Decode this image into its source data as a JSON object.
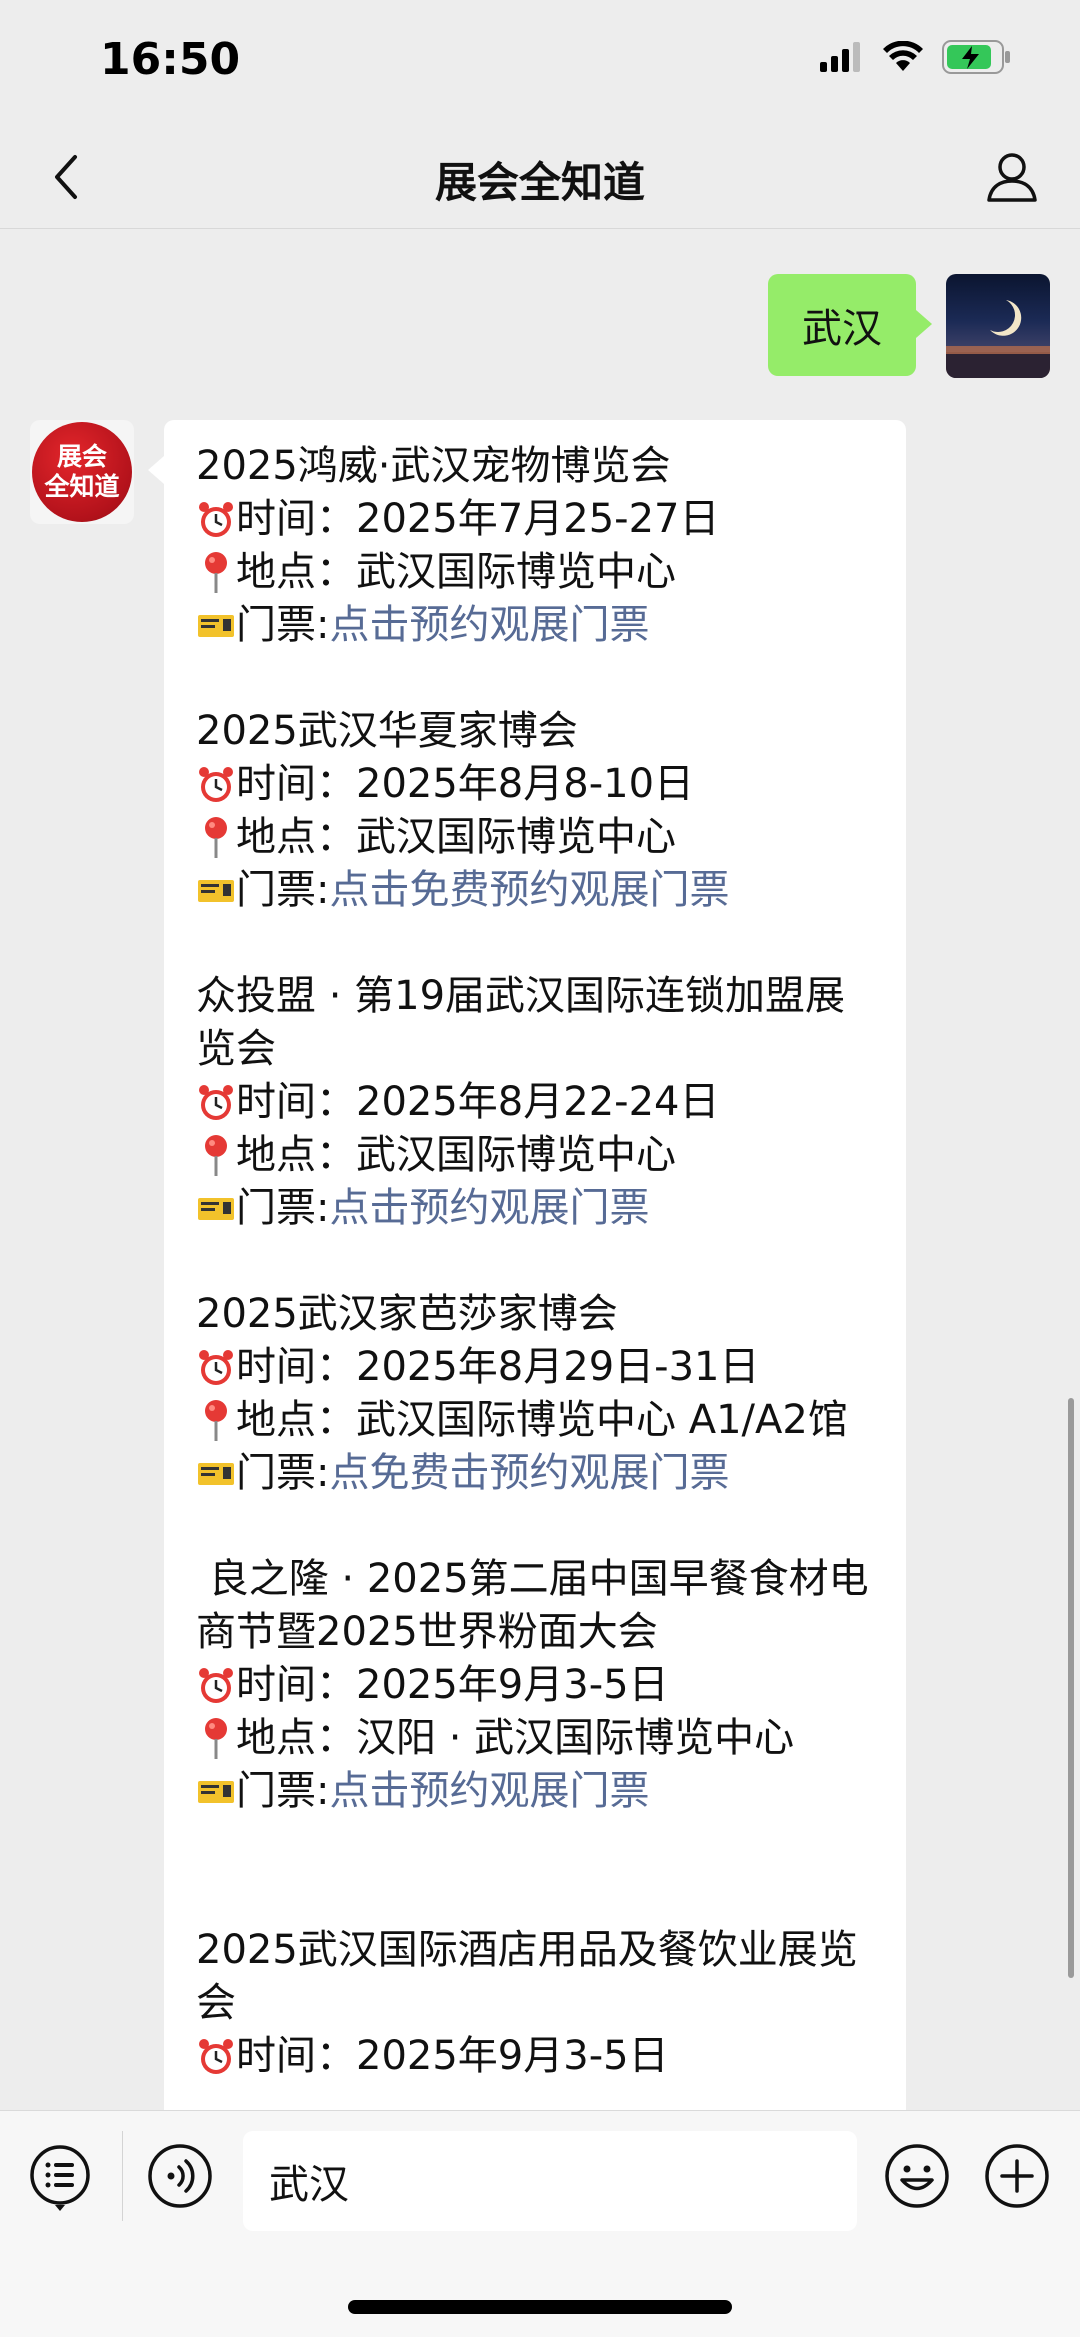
{
  "status_bar": {
    "time": "16:50"
  },
  "nav": {
    "title": "展会全知道"
  },
  "sent_message": {
    "text": "武汉"
  },
  "bot": {
    "avatar_line1": "展会",
    "avatar_line2": "全知道"
  },
  "events": [
    {
      "title": "2025鸿威·武汉宠物博览会",
      "time_label": "时间：",
      "time": "2025年7月25-27日",
      "venue_label": "地点：",
      "venue": "武汉国际博览中心",
      "ticket_label": "门票:",
      "ticket_link": "点击预约观展门票"
    },
    {
      "title": "2025武汉华夏家博会",
      "time_label": "时间：",
      "time": "2025年8月8-10日",
      "venue_label": "地点：",
      "venue": "武汉国际博览中心",
      "ticket_label": "门票:",
      "ticket_link": "点击免费预约观展门票"
    },
    {
      "title": "众投盟 · 第19届武汉国际连锁加盟展览会",
      "time_label": "时间：",
      "time": "2025年8月22-24日",
      "venue_label": "地点：",
      "venue": "武汉国际博览中心",
      "ticket_label": "门票:",
      "ticket_link": "点击预约观展门票"
    },
    {
      "title": "2025武汉家芭莎家博会",
      "time_label": "时间：",
      "time": "2025年8月29日-31日",
      "venue_label": "地点：",
      "venue": "武汉国际博览中心 A1/A2馆",
      "ticket_label": "门票:",
      "ticket_link": "点免费击预约观展门票"
    },
    {
      "title": " 良之隆 · 2025第二届中国早餐食材电商节暨2025世界粉面大会",
      "time_label": "时间：",
      "time": "2025年9月3-5日",
      "venue_label": "地点：",
      "venue": "汉阳 · 武汉国际博览中心",
      "ticket_label": "门票:",
      "ticket_link": "点击预约观展门票"
    },
    {
      "title": "2025武汉国际酒店用品及餐饮业展览会",
      "time_label": "时间：",
      "time": "2025年9月3-5日"
    }
  ],
  "input": {
    "value": "武汉"
  },
  "colors": {
    "chat_bg": "#ededed",
    "sent_bubble": "#95ec69",
    "link": "#576b95",
    "bot_avatar": "#c4161c"
  },
  "icons": {
    "alarm": "alarm-clock-icon",
    "pin": "location-pin-icon",
    "ticket": "ticket-icon"
  }
}
